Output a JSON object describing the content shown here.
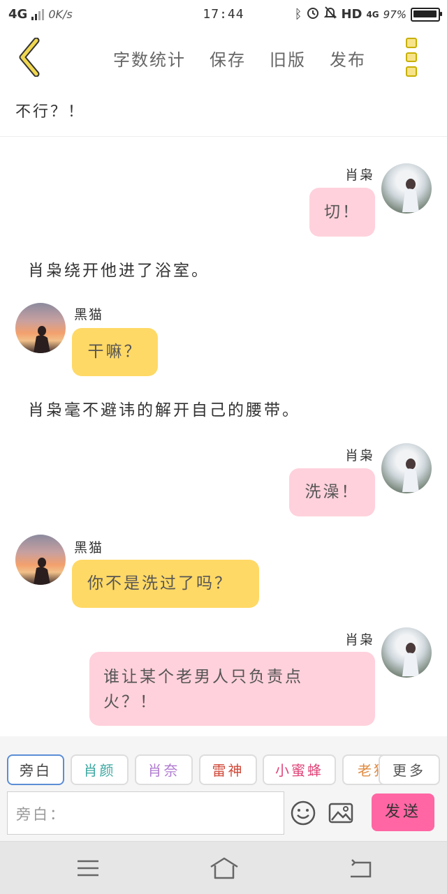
{
  "status_bar": {
    "network": "4G",
    "speed": "0K/s",
    "time": "17:44",
    "hd": "HD",
    "net2": "4G",
    "battery": "97%",
    "battery_level": 0.97
  },
  "toolbar": {
    "items": [
      "字数统计",
      "保存",
      "旧版",
      "发布"
    ],
    "accent": "#e0c600"
  },
  "title": "不行？！",
  "messages": [
    {
      "type": "bubble",
      "side": "right",
      "name": "肖枭",
      "text": "切！",
      "color": "#ffd1dc"
    },
    {
      "type": "narration",
      "text": "肖枭绕开他进了浴室。"
    },
    {
      "type": "bubble",
      "side": "left",
      "name": "黑猫",
      "text": "干嘛？",
      "color": "#ffd966"
    },
    {
      "type": "narration",
      "text": "肖枭毫不避讳的解开自己的腰带。"
    },
    {
      "type": "bubble",
      "side": "right",
      "name": "肖枭",
      "text": "洗澡！",
      "color": "#ffd1dc"
    },
    {
      "type": "bubble",
      "side": "left",
      "name": "黑猫",
      "text": "你不是洗过了吗？",
      "color": "#ffd966"
    },
    {
      "type": "bubble",
      "side": "right",
      "name": "肖枭",
      "lines": [
        "谁让某个老男人只负责点",
        "火？！"
      ],
      "color": "#ffd1dc"
    }
  ],
  "characters": [
    {
      "label": "旁白",
      "color": "#444444"
    },
    {
      "label": "肖颜",
      "color": "#3aa7a0"
    },
    {
      "label": "肖奈",
      "color": "#b07ad0"
    },
    {
      "label": "雷神",
      "color": "#d04a3a"
    },
    {
      "label": "小蜜蜂",
      "color": "#e0457a"
    },
    {
      "label": "老猫",
      "color": "#e08a40"
    }
  ],
  "more_label": "更多",
  "input_placeholder": "旁白：",
  "send_label": "发送",
  "send_color": "#ff66a3"
}
